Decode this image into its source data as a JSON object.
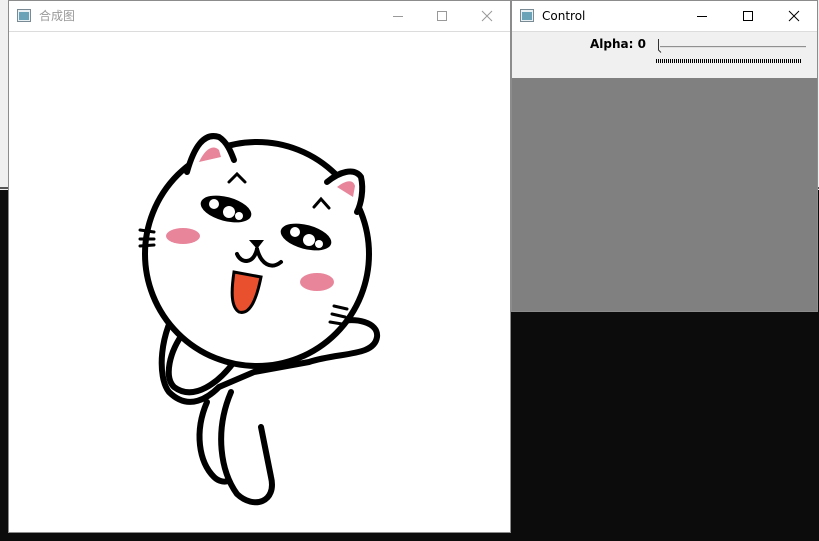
{
  "image_window": {
    "title": "合成图",
    "buttons": {
      "minimize": "minimize-icon",
      "maximize": "maximize-icon",
      "close": "close-icon"
    },
    "content": "cartoon-cat-image"
  },
  "control_window": {
    "title": "Control",
    "trackbar": {
      "label": "Alpha: 0",
      "value": 0
    },
    "buttons": {
      "minimize": "minimize-icon",
      "maximize": "maximize-icon",
      "close": "close-icon"
    }
  },
  "colors": {
    "panel_gray": "#808080",
    "desktop": "#0c0c0c",
    "cheek_pink": "#e8859a",
    "tongue": "#e8502e"
  }
}
